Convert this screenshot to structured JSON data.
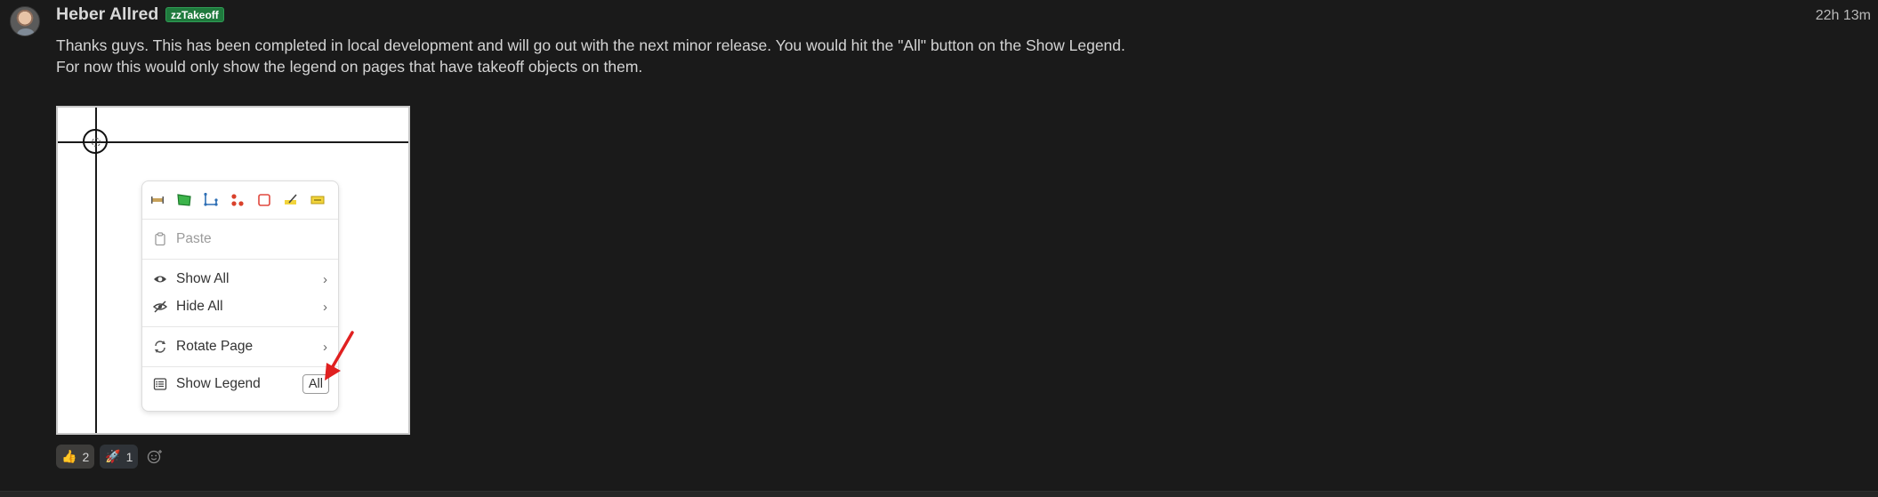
{
  "message": {
    "author": "Heber Allred",
    "badge": "zzTakeoff",
    "time": "22h 13m",
    "lines": [
      "Thanks guys. This has been completed in local development and will go out with the next minor release. You would hit the \"All\" button on the Show Legend.",
      "For now this would only show the legend on pages that have takeoff objects on them."
    ]
  },
  "attachment": {
    "menu": {
      "tools": [
        "linear-tool-icon",
        "area-tool-icon",
        "segment-tool-icon",
        "count-tool-icon",
        "rectangle-tool-icon",
        "highlight-tool-icon",
        "note-tool-icon"
      ],
      "paste": "Paste",
      "show_all": "Show All",
      "hide_all": "Hide All",
      "rotate_page": "Rotate Page",
      "show_legend": "Show Legend",
      "all_button": "All",
      "chevron": "›"
    },
    "annotation_color": "#e02020"
  },
  "reactions": [
    {
      "emoji": "👍",
      "count": "2"
    },
    {
      "emoji": "🚀",
      "count": "1"
    }
  ]
}
